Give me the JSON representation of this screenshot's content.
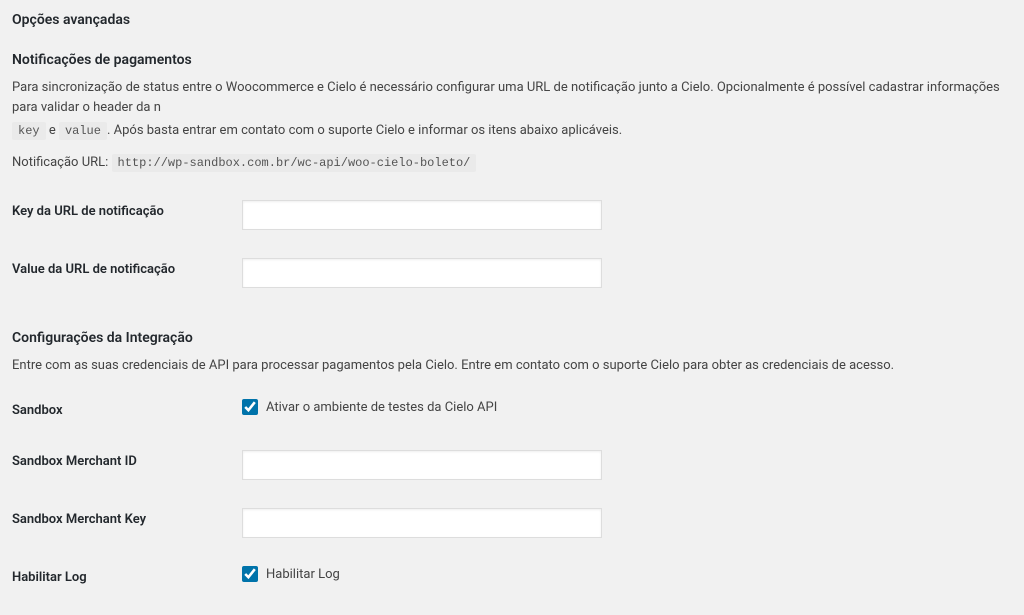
{
  "sections": {
    "advanced": {
      "title": "Opções avançadas"
    },
    "notifications": {
      "title": "Notificações de pagamentos",
      "desc_part1": "Para sincronização de status entre o Woocommerce e Cielo é necessário configurar uma URL de notificação junto a Cielo. Opcionalmente é possível cadastrar informações para validar o header da n",
      "code_key": "key",
      "desc_e": " e ",
      "code_value": "value",
      "desc_part2": ". Após basta entrar em contato com o suporte Cielo e informar os itens abaixo aplicáveis.",
      "url_label": "Notificação URL: ",
      "url_value": "http://wp-sandbox.com.br/wc-api/woo-cielo-boleto/",
      "fields": {
        "key_label": "Key da URL de notificação",
        "value_label": "Value da URL de notificação"
      }
    },
    "integration": {
      "title": "Configurações da Integração",
      "desc": "Entre com as suas credenciais de API para processar pagamentos pela Cielo. Entre em contato com o suporte Cielo para obter as credenciais de acesso.",
      "fields": {
        "sandbox_label": "Sandbox",
        "sandbox_checkbox_text": "Ativar o ambiente de testes da Cielo API",
        "sandbox_checked": true,
        "merchant_id_label": "Sandbox Merchant ID",
        "merchant_key_label": "Sandbox Merchant Key",
        "log_label": "Habilitar Log",
        "log_checkbox_text": "Habilitar Log",
        "log_checked": true
      }
    }
  }
}
